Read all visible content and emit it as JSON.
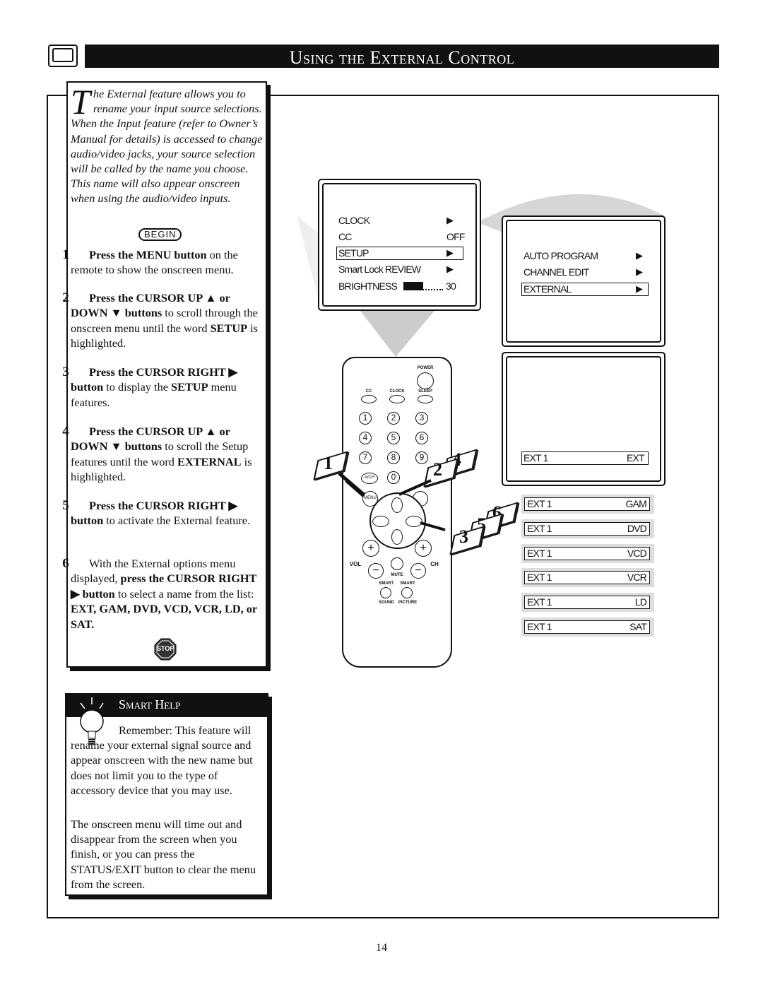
{
  "header": {
    "title": "Using the External Control",
    "icon": "tv-icon"
  },
  "intro": {
    "dropcap": "T",
    "text": "he External feature allows you to rename your input source selections. When the Input feature (refer to Owner’s Manual for details) is accessed to change audio/video jacks, your source selection will be called by the name you choose. This name will also appear onscreen when using the audio/video inputs."
  },
  "begin_label": "BEGIN",
  "steps": [
    {
      "num": "1",
      "bold": "Press the MENU button",
      "text": " on the remote to show the onscreen menu."
    },
    {
      "num": "2",
      "bold": "Press the CURSOR UP ▲ or DOWN ▼ buttons",
      "text": " to scroll through the onscreen menu until the word ",
      "bold2": "SETUP",
      "text2": " is highlighted."
    },
    {
      "num": "3",
      "bold": "Press the CURSOR RIGHT ▶ button",
      "text": " to display the ",
      "bold2": "SETUP",
      "text2": " menu features."
    },
    {
      "num": "4",
      "bold": "Press the CURSOR UP ▲ or DOWN ▼ buttons",
      "text": " to scroll the Setup features until the word ",
      "bold2": "EXTERNAL",
      "text2": " is highlighted."
    },
    {
      "num": "5",
      "bold": "Press the CURSOR RIGHT ▶ button",
      "text": " to activate the External feature.",
      "bold2": "",
      "text2": ""
    },
    {
      "num": "6",
      "bold": "",
      "text": "With the External options menu displayed, ",
      "bold2": "press the CURSOR RIGHT ▶ button",
      "text2": " to select a name from the list: ",
      "bold3": "EXT, GAM, DVD, VCD, VCR, LD, or SAT."
    }
  ],
  "stop_label": "STOP",
  "smart_help": {
    "title": "Smart Help",
    "p1": "Remember: This feature will rename your external signal source and appear onscreen with the new name but does not limit you to the type of accessory device that you may use.",
    "p2": "The onscreen menu will time out and disappear from the screen when you finish, or you can press the STATUS/EXIT button to clear the menu from the screen."
  },
  "menu1": {
    "items": [
      {
        "label": "CLOCK",
        "value": "▶"
      },
      {
        "label": "CC",
        "value": "OFF"
      },
      {
        "label": "SETUP",
        "value": "▶",
        "highlighted": true
      },
      {
        "label": "Smart Lock REVIEW",
        "value": "▶"
      },
      {
        "label": "BRIGHTNESS",
        "value": "30",
        "level": 30
      }
    ]
  },
  "menu2": {
    "items": [
      {
        "label": "AUTO PROGRAM",
        "value": "▶"
      },
      {
        "label": "CHANNEL EDIT",
        "value": "▶"
      },
      {
        "label": "EXTERNAL",
        "value": "▶",
        "highlighted": true
      }
    ]
  },
  "menu3": {
    "label": "EXT 1",
    "value": "EXT"
  },
  "options": [
    {
      "label": "EXT 1",
      "value": "GAM"
    },
    {
      "label": "EXT 1",
      "value": "DVD"
    },
    {
      "label": "EXT 1",
      "value": "VCD"
    },
    {
      "label": "EXT 1",
      "value": "VCR"
    },
    {
      "label": "EXT 1",
      "value": "LD"
    },
    {
      "label": "EXT 1",
      "value": "SAT"
    }
  ],
  "remote": {
    "power": "POWER",
    "cc": "CC",
    "clock": "CLOCK",
    "sleep": "SLEEP",
    "digits": [
      "1",
      "2",
      "3",
      "4",
      "5",
      "6",
      "7",
      "8",
      "9",
      "0"
    ],
    "ach": "A/CH",
    "menu": "MENU",
    "vol": "VOL",
    "ch": "CH",
    "mute": "MUTE",
    "smart1": "SMART",
    "smart2": "SMART",
    "sound": "SOUND",
    "picture": "PICTURE",
    "plus": "+",
    "minus": "−"
  },
  "callouts": [
    "1",
    "2",
    "4",
    "3",
    "5",
    "6"
  ],
  "page_number": "14"
}
